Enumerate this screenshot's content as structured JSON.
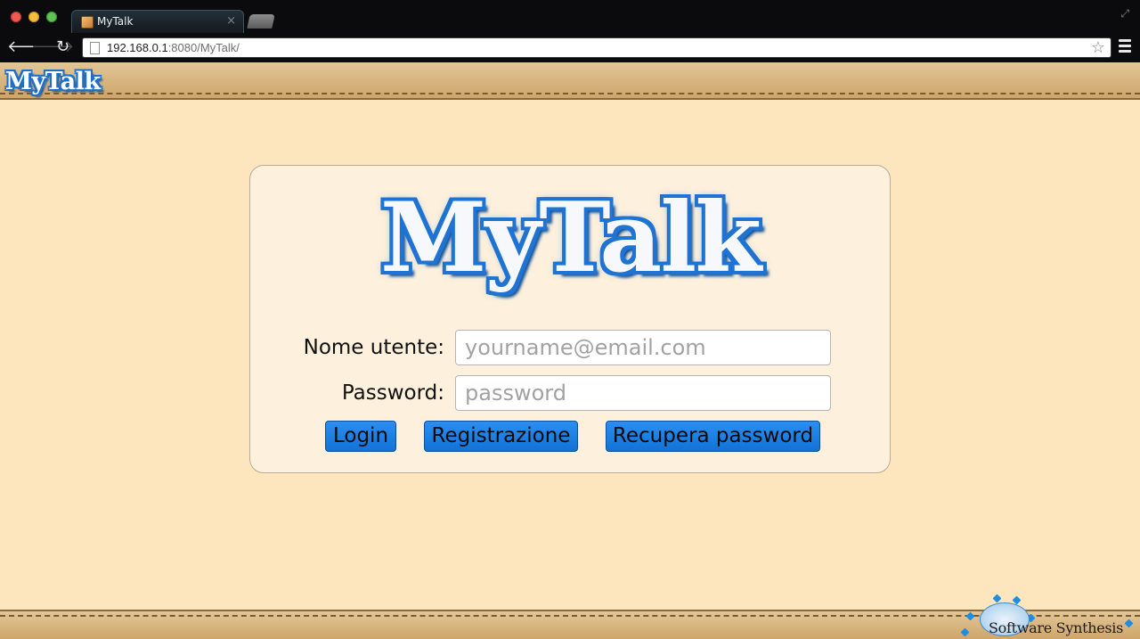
{
  "browser": {
    "tab_title": "MyTalk",
    "tab_close": "×",
    "url_host": "192.168.0.1",
    "url_rest": ":8080/MyTalk/",
    "icons": {
      "back": "arrow-left-icon",
      "forward": "arrow-right-icon",
      "reload": "reload-icon",
      "star": "star-icon",
      "menu": "menu-icon"
    }
  },
  "header": {
    "logo": "MyTalk"
  },
  "login": {
    "logo": "MyTalk",
    "username_label": "Nome utente:",
    "username_placeholder": "yourname@email.com",
    "username_value": "",
    "password_label": "Password:",
    "password_placeholder": "password",
    "password_value": "",
    "login_button": "Login",
    "register_button": "Registrazione",
    "recover_button": "Recupera password"
  },
  "footer": {
    "brand": "Software Synthesis"
  },
  "colors": {
    "page_background": "#fde5bd",
    "card_background": "#fdf0dc",
    "button_blue": "#1f7fe3",
    "logo_blue": "#1f73d2"
  }
}
